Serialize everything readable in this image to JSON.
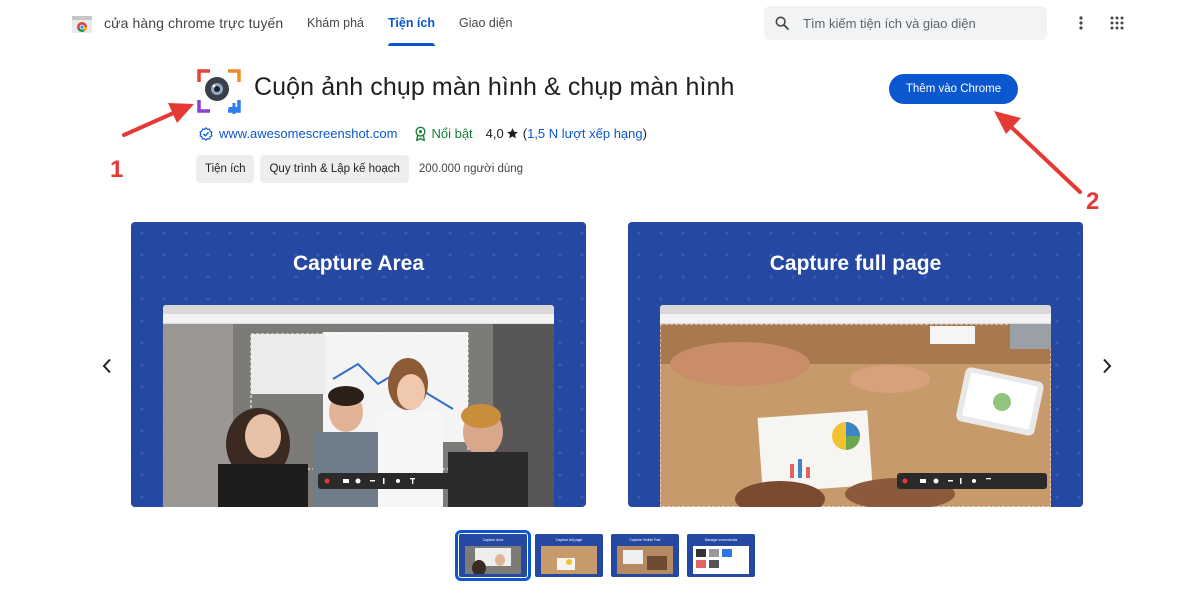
{
  "header": {
    "store_name": "cửa hàng chrome trực tuyến",
    "nav": [
      {
        "label": "Khám phá",
        "active": false
      },
      {
        "label": "Tiện ích",
        "active": true
      },
      {
        "label": "Giao diện",
        "active": false
      }
    ],
    "search_placeholder": "Tìm kiếm tiện ích và giao diện",
    "icons": [
      "chrome-logo-icon",
      "search-icon",
      "more-vert-icon",
      "apps-grid-icon"
    ]
  },
  "listing": {
    "title": "Cuộn ảnh chụp màn hình & chụp màn hình",
    "add_button": "Thêm vào Chrome",
    "website": "www.awesomescreenshot.com",
    "featured": "Nổi bật",
    "rating": "4,0",
    "rating_count": "1,5 N lượt xếp hạng",
    "paren_open": "(",
    "paren_close": ")",
    "chips": [
      "Tiện ích",
      "Quy trình & Lập kế hoạch"
    ],
    "users": "200.000 người dùng"
  },
  "annotations": {
    "one": "1",
    "two": "2",
    "color": "#e53935"
  },
  "carousel": {
    "slides": [
      {
        "title": "Capture Area"
      },
      {
        "title": "Capture full page"
      }
    ],
    "thumbnails": [
      {
        "label": "Capture Area",
        "selected": true
      },
      {
        "label": "Capture full page",
        "selected": false
      },
      {
        "label": "Capture Visible Part",
        "selected": false
      },
      {
        "label": "Manage screenshots",
        "selected": false
      }
    ]
  },
  "colors": {
    "accent": "#0b57d0",
    "slide_bg": "#2548a3",
    "featured": "#188038"
  }
}
